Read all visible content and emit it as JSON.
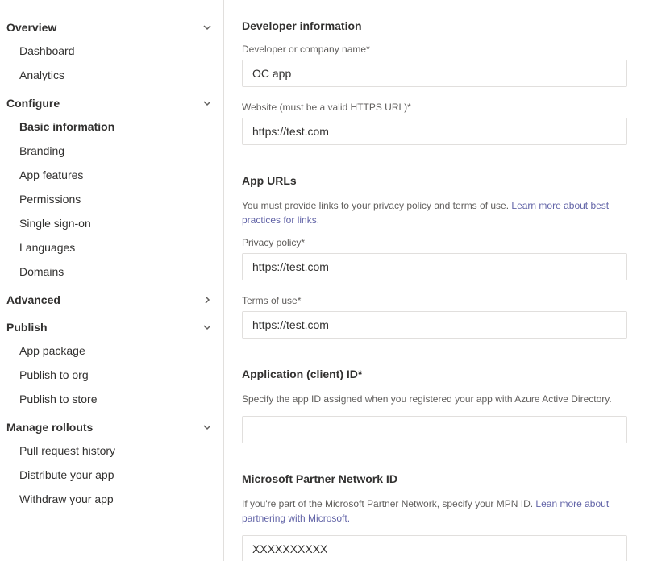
{
  "sidebar": {
    "groups": [
      {
        "label": "Overview",
        "expanded": true,
        "items": [
          {
            "label": "Dashboard",
            "active": false
          },
          {
            "label": "Analytics",
            "active": false
          }
        ]
      },
      {
        "label": "Configure",
        "expanded": true,
        "items": [
          {
            "label": "Basic information",
            "active": true
          },
          {
            "label": "Branding",
            "active": false
          },
          {
            "label": "App features",
            "active": false
          },
          {
            "label": "Permissions",
            "active": false
          },
          {
            "label": "Single sign-on",
            "active": false
          },
          {
            "label": "Languages",
            "active": false
          },
          {
            "label": "Domains",
            "active": false
          }
        ]
      },
      {
        "label": "Advanced",
        "expanded": false,
        "items": []
      },
      {
        "label": "Publish",
        "expanded": true,
        "items": [
          {
            "label": "App package",
            "active": false
          },
          {
            "label": "Publish to org",
            "active": false
          },
          {
            "label": "Publish to store",
            "active": false
          }
        ]
      },
      {
        "label": "Manage rollouts",
        "expanded": true,
        "items": [
          {
            "label": "Pull request history",
            "active": false
          },
          {
            "label": "Distribute your app",
            "active": false
          },
          {
            "label": "Withdraw your app",
            "active": false
          }
        ]
      }
    ]
  },
  "main": {
    "devInfo": {
      "title": "Developer information",
      "companyLabel": "Developer or company name*",
      "companyValue": "OC app",
      "websiteLabel": "Website (must be a valid HTTPS URL)*",
      "websiteValue": "https://test.com"
    },
    "appUrls": {
      "title": "App URLs",
      "descPrefix": "You must provide links to your privacy policy and terms of use. ",
      "descLink": "Learn more about best practices for links.",
      "privacyLabel": "Privacy policy*",
      "privacyValue": "https://test.com",
      "termsLabel": "Terms of use*",
      "termsValue": "https://test.com"
    },
    "clientId": {
      "title": "Application (client) ID*",
      "desc": "Specify the app ID assigned when you registered your app with Azure Active Directory.",
      "value": ""
    },
    "mpn": {
      "title": "Microsoft Partner Network ID",
      "descPrefix": "If you're part of the Microsoft Partner Network, specify your MPN ID. ",
      "descLink": "Lean more about partnering with Microsoft.",
      "value": "XXXXXXXXXX"
    }
  }
}
